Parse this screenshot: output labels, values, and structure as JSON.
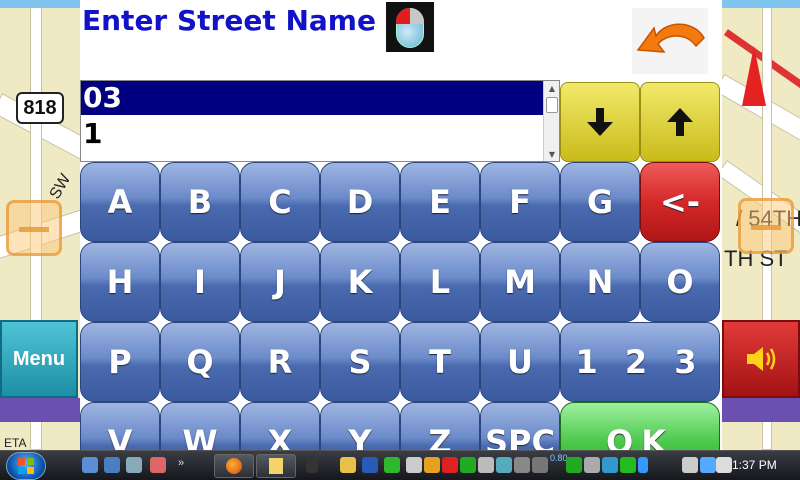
{
  "map": {
    "route_shield": "818",
    "street_labels": [
      "/ 54TH",
      "TH ST"
    ],
    "left_road_label": "SW",
    "menu_label": "Menu",
    "eta_label": "ETA"
  },
  "dialog": {
    "title": "Enter Street Name",
    "results": [
      "03",
      "1"
    ],
    "selected_index": 0
  },
  "keyboard": {
    "rows": [
      [
        "A",
        "B",
        "C",
        "D",
        "E",
        "F",
        "G",
        "<-"
      ],
      [
        "H",
        "I",
        "J",
        "K",
        "L",
        "M",
        "N",
        "O"
      ],
      [
        "P",
        "Q",
        "R",
        "S",
        "T",
        "U",
        "1 2 3"
      ],
      [
        "V",
        "W",
        "X",
        "Y",
        "Z",
        "SPC",
        "OK"
      ]
    ]
  },
  "taskbar": {
    "clock": "1:37 PM",
    "overflow": "»",
    "battery_text": "0.80"
  },
  "colors": {
    "title_blue": "#1212c8",
    "selection_navy": "#000080",
    "key_blue": "#4a6aaf",
    "delete_red": "#d42828",
    "ok_green": "#4cc84c",
    "nav_yellow": "#c9bb1a"
  },
  "icons": {
    "back": "undo-arrow-icon",
    "down": "arrow-down-icon",
    "up": "arrow-up-icon",
    "mouse": "mouse-icon",
    "volume": "speaker-icon",
    "start": "windows-start-icon"
  }
}
